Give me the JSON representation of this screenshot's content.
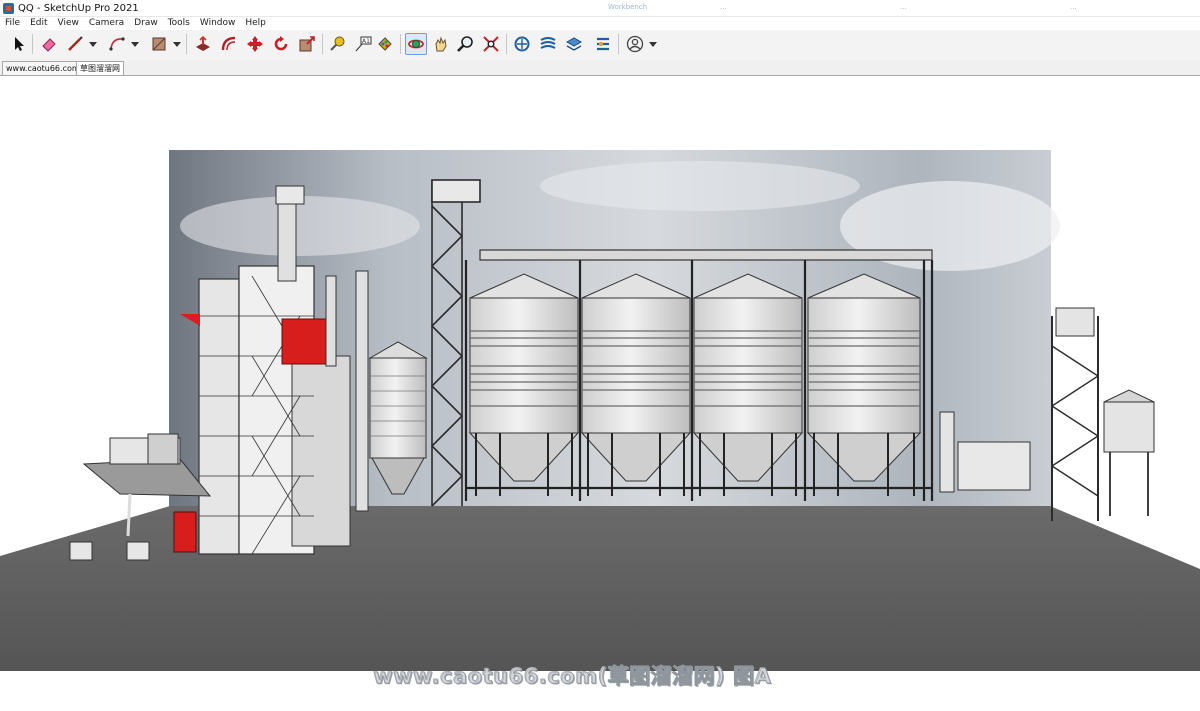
{
  "window": {
    "title": "QQ - SketchUp Pro 2021",
    "app_icon": "sketchup-app-icon",
    "background_tabs": [
      "Workbench",
      "...",
      "...",
      "..."
    ]
  },
  "menu": {
    "items": [
      "File",
      "Edit",
      "View",
      "Camera",
      "Draw",
      "Tools",
      "Window",
      "Help"
    ]
  },
  "toolbar": {
    "tools": [
      {
        "name": "select-tool-icon",
        "active": false
      },
      {
        "name": "eraser-tool-icon",
        "active": false
      },
      {
        "name": "line-tool-icon",
        "active": false,
        "dropdown": true
      },
      {
        "name": "arc-tool-icon",
        "active": false,
        "dropdown": true
      },
      {
        "name": "rectangle-tool-icon",
        "active": false,
        "dropdown": true
      },
      {
        "name": "push-pull-tool-icon",
        "active": false
      },
      {
        "name": "offset-tool-icon",
        "active": false
      },
      {
        "name": "move-tool-icon",
        "active": false
      },
      {
        "name": "rotate-tool-icon",
        "active": false
      },
      {
        "name": "scale-tool-icon",
        "active": false
      },
      {
        "name": "tape-measure-tool-icon",
        "active": false
      },
      {
        "name": "text-tool-icon",
        "active": false
      },
      {
        "name": "paint-bucket-tool-icon",
        "active": false
      },
      {
        "name": "orbit-tool-icon",
        "active": true
      },
      {
        "name": "pan-tool-icon",
        "active": false
      },
      {
        "name": "zoom-tool-icon",
        "active": false
      },
      {
        "name": "zoom-extents-tool-icon",
        "active": false
      },
      {
        "name": "warehouse-icon",
        "active": false
      },
      {
        "name": "extension-warehouse-icon",
        "active": false
      },
      {
        "name": "layout-icon",
        "active": false
      },
      {
        "name": "extension-manager-icon",
        "active": false
      },
      {
        "name": "account-icon",
        "active": false,
        "dropdown": true
      }
    ]
  },
  "scene_tabs": [
    {
      "label": "www.caotu66.com",
      "selected": false
    },
    {
      "label": "草图溜溜网",
      "selected": true
    }
  ],
  "viewport": {
    "watermark": "www.caotu66.com(草图溜溜网) 图A",
    "colors": {
      "ground": "#5d5d5d",
      "steel": "#2b2b2b",
      "silo": "#e4e4e4",
      "accent_red": "#d81d1d"
    }
  }
}
